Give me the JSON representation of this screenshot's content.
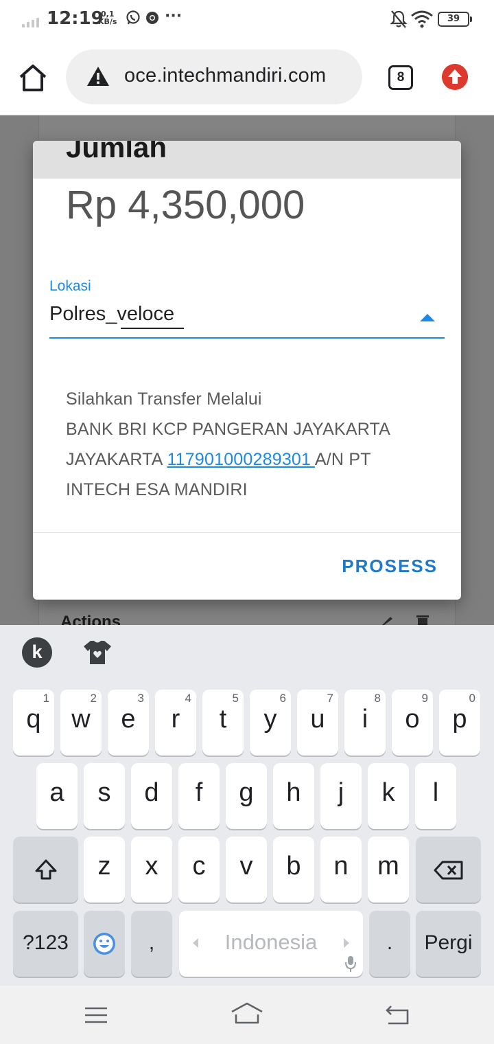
{
  "status_bar": {
    "time": "12:19",
    "speed_value": "0,1",
    "speed_unit": "KB/s",
    "more": "···",
    "battery": "39",
    "icons": [
      "signal-icon",
      "whatsapp-icon",
      "chrome-icon",
      "bell-off-icon",
      "wifi-icon",
      "battery-icon"
    ]
  },
  "browser": {
    "url": "oce.intechmandiri.com",
    "tab_count": "8",
    "icons": [
      "home-icon",
      "warning-icon",
      "update-icon"
    ]
  },
  "background_page": {
    "actions_label": "Actions"
  },
  "modal": {
    "header_title": "Jumlah",
    "amount": "Rp 4,350,000",
    "location_label": "Lokasi",
    "location_value": "Polres_veloce",
    "transfer_line1": "Silahkan Transfer Melalui",
    "transfer_line2": "BANK BRI KCP PANGERAN JAYAKARTA",
    "transfer_line3_prefix": "JAYAKARTA ",
    "account_number": "117901000289301 ",
    "transfer_line3_suffix": "A/N PT",
    "transfer_line4": "INTECH ESA MANDIRI",
    "process_button": "PROSESS"
  },
  "keyboard": {
    "row1": [
      {
        "ch": "q",
        "num": "1"
      },
      {
        "ch": "w",
        "num": "2"
      },
      {
        "ch": "e",
        "num": "3"
      },
      {
        "ch": "r",
        "num": "4"
      },
      {
        "ch": "t",
        "num": "5"
      },
      {
        "ch": "y",
        "num": "6"
      },
      {
        "ch": "u",
        "num": "7"
      },
      {
        "ch": "i",
        "num": "8"
      },
      {
        "ch": "o",
        "num": "9"
      },
      {
        "ch": "p",
        "num": "0"
      }
    ],
    "row2": [
      "a",
      "s",
      "d",
      "f",
      "g",
      "h",
      "j",
      "k",
      "l"
    ],
    "row3": [
      "z",
      "x",
      "c",
      "v",
      "b",
      "n",
      "m"
    ],
    "symbols_key": "?123",
    "comma_key": ",",
    "space_label": "Indonesia",
    "period_key": ".",
    "enter_key": "Pergi"
  },
  "colors": {
    "accent": "#1e88e5",
    "update_badge": "#dc3a2f",
    "overlay": "#7e7e7e",
    "keyboard_bg": "#e8eaed"
  }
}
